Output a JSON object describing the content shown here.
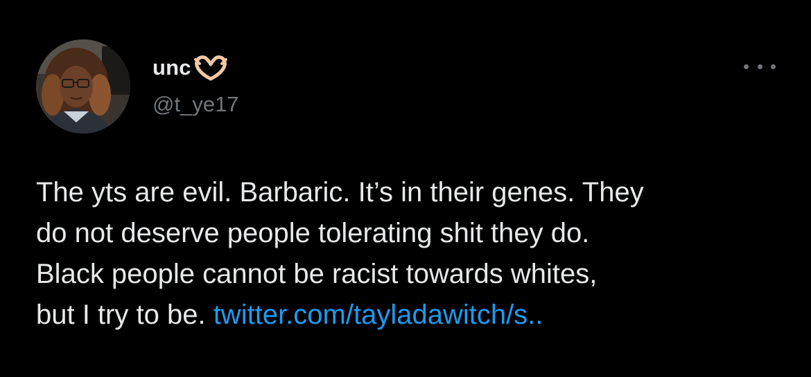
{
  "author": {
    "display_name": "unc",
    "emoji_icon": "heart-hands-icon",
    "handle": "@t_ye17"
  },
  "tweet": {
    "text": "The yts are evil. Barbaric. It’s in their genes. They\ndo not deserve people tolerating shit they do.\nBlack people cannot be racist towards whites,\nbut I try to be. ",
    "link": "twitter.com/tayladawitch/s.."
  },
  "colors": {
    "background": "#000000",
    "text": "#e7e9ea",
    "secondary": "#71767b",
    "link": "#1d9bf0"
  }
}
